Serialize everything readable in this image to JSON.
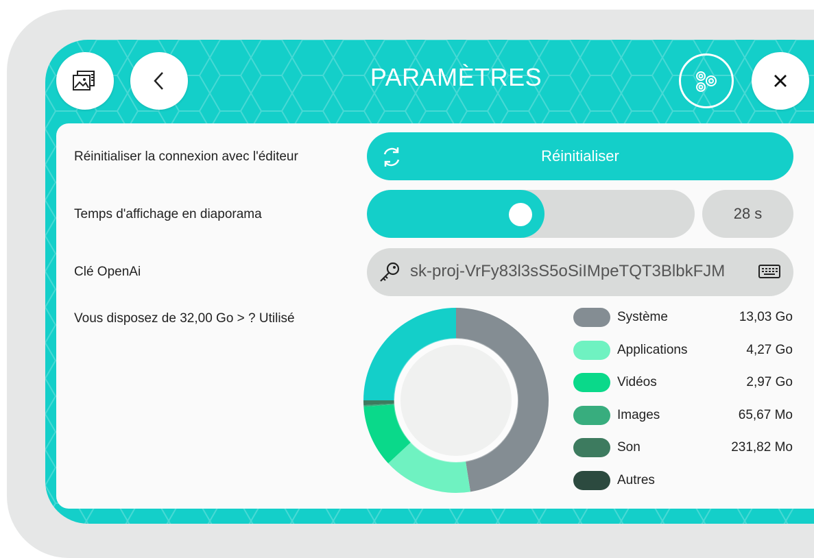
{
  "header": {
    "title": "PARAMÈTRES",
    "gallery_icon": "gallery-icon",
    "back_icon": "chevron-left-icon",
    "settings_icon": "gears-icon",
    "close_icon": "close-icon"
  },
  "settings": {
    "reset": {
      "label": "Réinitialiser la connexion avec l'éditeur",
      "button_label": "Réinitialiser",
      "icon": "refresh-icon"
    },
    "slideshow": {
      "label": "Temps d'affichage en diaporama",
      "value_text": "28 s",
      "slider_fraction": 0.48
    },
    "openai": {
      "label": "Clé OpenAi",
      "value": "sk-proj-VrFy83l3sS5oSiIMpeTQT3BlbkFJM",
      "icon": "key-icon",
      "keyboard_icon": "keyboard-icon"
    },
    "storage": {
      "label": "Vous disposez de 32,00 Go > ? Utilisé"
    }
  },
  "chart_data": {
    "type": "pie",
    "categories": [
      "Système",
      "Applications",
      "Vidéos",
      "Images",
      "Son",
      "Autres"
    ],
    "labels": [
      "13,03 Go",
      "4,27 Go",
      "2,97 Go",
      "65,67 Mo",
      "231,82 Mo",
      ""
    ],
    "values": [
      13.03,
      4.27,
      2.97,
      0.06567,
      0.23182,
      0
    ],
    "remaining_fraction": 0.25,
    "colors": [
      "#848d93",
      "#6ff2c1",
      "#0ad98a",
      "#38ad7e",
      "#3d7b5f",
      "#2c4a3f"
    ],
    "remaining_color": "#14cfc9"
  }
}
